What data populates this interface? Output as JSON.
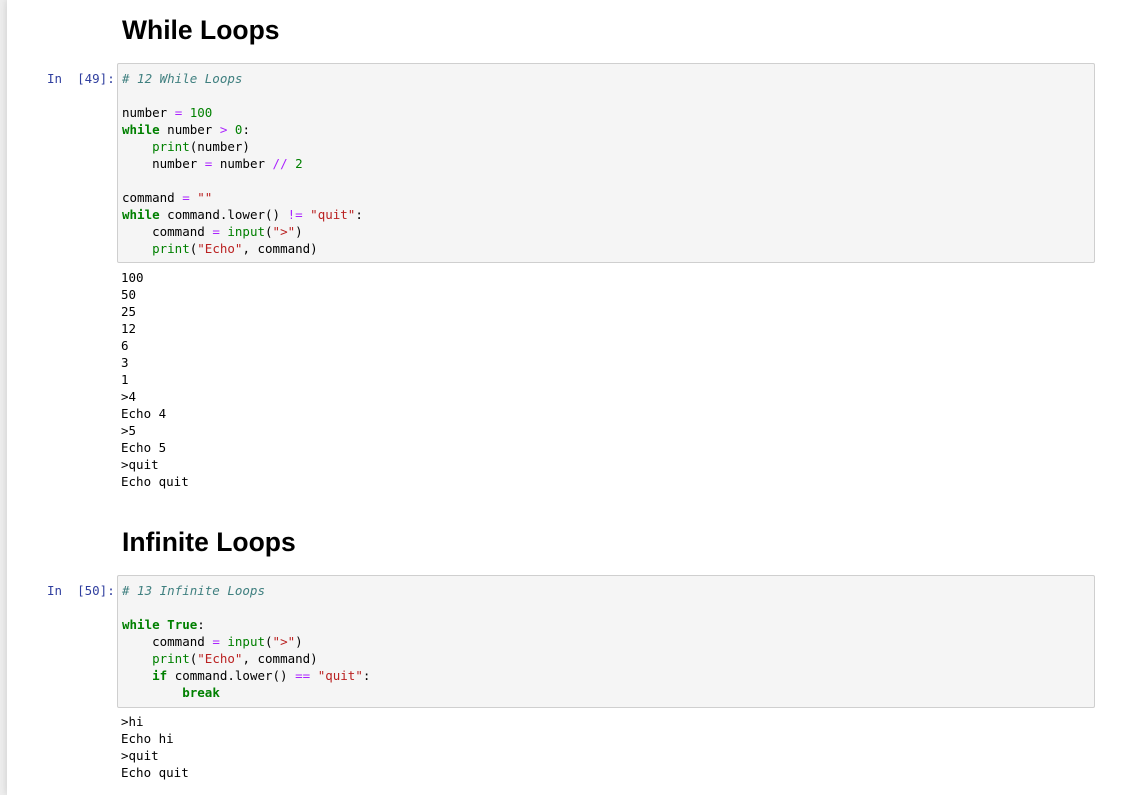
{
  "cells": [
    {
      "heading": "While Loops",
      "prompt": "In  [49]:",
      "code_lines": [
        [
          {
            "t": "comment",
            "v": "# 12 While Loops"
          }
        ],
        [],
        [
          {
            "t": "name",
            "v": "number "
          },
          {
            "t": "op",
            "v": "="
          },
          {
            "t": "name",
            "v": " "
          },
          {
            "t": "num",
            "v": "100"
          }
        ],
        [
          {
            "t": "kw",
            "v": "while"
          },
          {
            "t": "name",
            "v": " number "
          },
          {
            "t": "op",
            "v": ">"
          },
          {
            "t": "name",
            "v": " "
          },
          {
            "t": "num",
            "v": "0"
          },
          {
            "t": "name",
            "v": ":"
          }
        ],
        [
          {
            "t": "name",
            "v": "    "
          },
          {
            "t": "builtin",
            "v": "print"
          },
          {
            "t": "name",
            "v": "(number)"
          }
        ],
        [
          {
            "t": "name",
            "v": "    number "
          },
          {
            "t": "op",
            "v": "="
          },
          {
            "t": "name",
            "v": " number "
          },
          {
            "t": "op",
            "v": "//"
          },
          {
            "t": "name",
            "v": " "
          },
          {
            "t": "num",
            "v": "2"
          }
        ],
        [],
        [
          {
            "t": "name",
            "v": "command "
          },
          {
            "t": "op",
            "v": "="
          },
          {
            "t": "name",
            "v": " "
          },
          {
            "t": "str",
            "v": "\"\""
          }
        ],
        [
          {
            "t": "kw",
            "v": "while"
          },
          {
            "t": "name",
            "v": " command.lower() "
          },
          {
            "t": "op",
            "v": "!="
          },
          {
            "t": "name",
            "v": " "
          },
          {
            "t": "str",
            "v": "\"quit\""
          },
          {
            "t": "name",
            "v": ":"
          }
        ],
        [
          {
            "t": "name",
            "v": "    command "
          },
          {
            "t": "op",
            "v": "="
          },
          {
            "t": "name",
            "v": " "
          },
          {
            "t": "builtin",
            "v": "input"
          },
          {
            "t": "name",
            "v": "("
          },
          {
            "t": "str",
            "v": "\">\""
          },
          {
            "t": "name",
            "v": ")"
          }
        ],
        [
          {
            "t": "name",
            "v": "    "
          },
          {
            "t": "builtin",
            "v": "print"
          },
          {
            "t": "name",
            "v": "("
          },
          {
            "t": "str",
            "v": "\"Echo\""
          },
          {
            "t": "name",
            "v": ", command)"
          }
        ]
      ],
      "output": "100\n50\n25\n12\n6\n3\n1\n>4\nEcho 4\n>5\nEcho 5\n>quit\nEcho quit"
    },
    {
      "heading": "Infinite Loops",
      "prompt": "In  [50]:",
      "code_lines": [
        [
          {
            "t": "comment",
            "v": "# 13 Infinite Loops"
          }
        ],
        [],
        [
          {
            "t": "kw",
            "v": "while"
          },
          {
            "t": "name",
            "v": " "
          },
          {
            "t": "kw",
            "v": "True"
          },
          {
            "t": "name",
            "v": ":"
          }
        ],
        [
          {
            "t": "name",
            "v": "    command "
          },
          {
            "t": "op",
            "v": "="
          },
          {
            "t": "name",
            "v": " "
          },
          {
            "t": "builtin",
            "v": "input"
          },
          {
            "t": "name",
            "v": "("
          },
          {
            "t": "str",
            "v": "\">\""
          },
          {
            "t": "name",
            "v": ")"
          }
        ],
        [
          {
            "t": "name",
            "v": "    "
          },
          {
            "t": "builtin",
            "v": "print"
          },
          {
            "t": "name",
            "v": "("
          },
          {
            "t": "str",
            "v": "\"Echo\""
          },
          {
            "t": "name",
            "v": ", command)"
          }
        ],
        [
          {
            "t": "name",
            "v": "    "
          },
          {
            "t": "kw",
            "v": "if"
          },
          {
            "t": "name",
            "v": " command.lower() "
          },
          {
            "t": "op",
            "v": "=="
          },
          {
            "t": "name",
            "v": " "
          },
          {
            "t": "str",
            "v": "\"quit\""
          },
          {
            "t": "name",
            "v": ":"
          }
        ],
        [
          {
            "t": "name",
            "v": "        "
          },
          {
            "t": "kw",
            "v": "break"
          }
        ]
      ],
      "output": ">hi\nEcho hi\n>quit\nEcho quit"
    }
  ],
  "colors": {
    "prompt": "#303f9f",
    "keyword": "#008000",
    "operator": "#aa22ff",
    "string": "#ba2121",
    "comment": "#408080",
    "cell_background": "#f5f5f5",
    "cell_border": "#cfcfcf"
  }
}
